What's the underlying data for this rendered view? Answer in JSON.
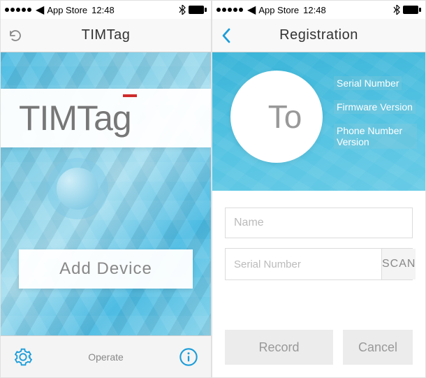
{
  "status": {
    "carrier": "App Store",
    "time": "12:48",
    "icons": {
      "bluetooth": "bluetooth-icon",
      "battery": "battery-icon"
    }
  },
  "left": {
    "nav_title": "TIMTag",
    "overlay_title": "TIMTag",
    "add_device_label": "Add Device",
    "bottom_center": "Operate"
  },
  "right": {
    "nav_title": "Registration",
    "avatar_placeholder": "To",
    "info": {
      "serial_label": "Serial Number",
      "firmware_label": "Firmware Version",
      "phone_label": "Phone Number Version"
    },
    "form": {
      "name_placeholder": "Name",
      "serial_placeholder": "Serial Number",
      "scan_label": "SCAN"
    },
    "buttons": {
      "record": "Record",
      "cancel": "Cancel"
    }
  },
  "colors": {
    "accent": "#1b9dd9",
    "teal": "#3fb6db"
  }
}
